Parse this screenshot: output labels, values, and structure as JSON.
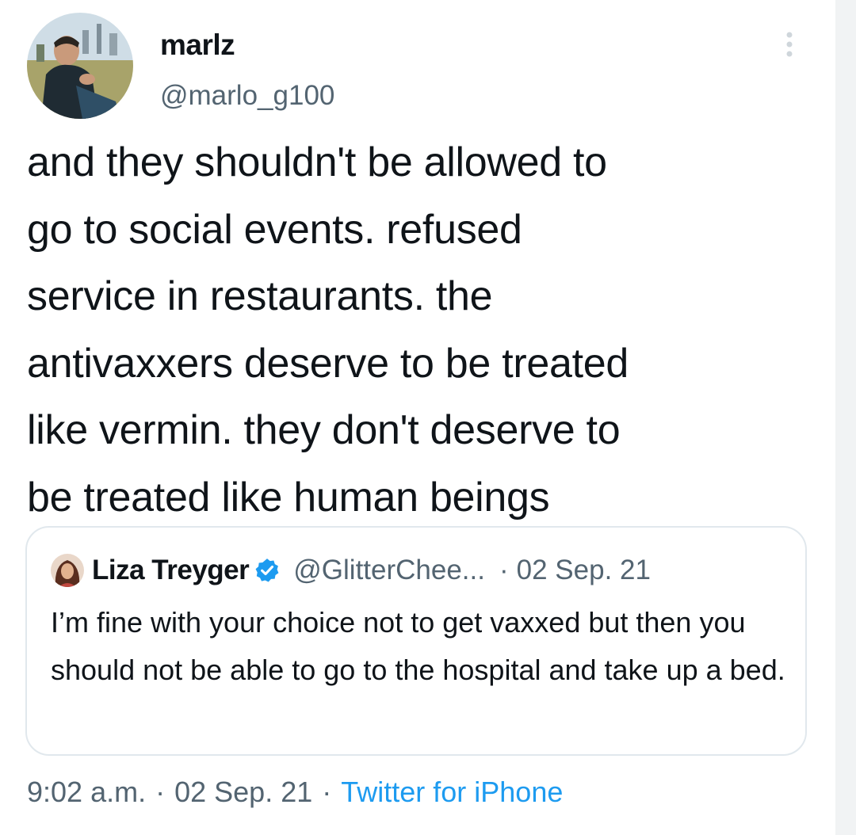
{
  "tweet": {
    "author": {
      "display_name": "marlz",
      "handle": "@marlo_g100",
      "avatar_icon": "user-photo-avatar"
    },
    "menu_icon": "more-vertical-icon",
    "text": "and they shouldn't be allowed to\ngo to social events. refused\nservice in restaurants. the\nantivaxxers deserve to be treated\nlike vermin. they don't deserve to\nbe treated like human beings",
    "quoted_tweet": {
      "display_name": "Liza Treyger",
      "verified_icon": "verified-badge-icon",
      "handle": "@GlitterChee...",
      "separator": "·",
      "date": "02 Sep. 21",
      "text": "I’m fine with your choice not to get vaxxed but then you should not be able to go to the hospital and take up a bed."
    },
    "meta": {
      "time": "9:02 a.m.",
      "separator": "·",
      "date": "02 Sep. 21",
      "source": "Twitter for iPhone"
    }
  },
  "colors": {
    "text_primary": "#0f1419",
    "text_secondary": "#536471",
    "link_blue": "#1d9bf0",
    "card_border": "#e1e8ed"
  }
}
